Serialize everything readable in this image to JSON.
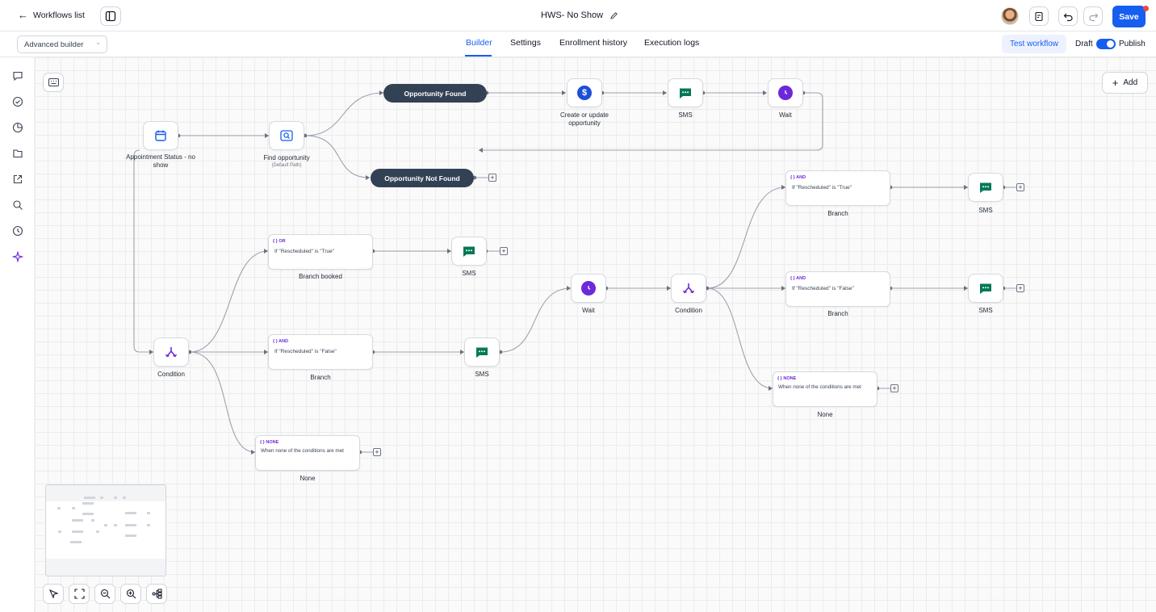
{
  "header": {
    "back_label": "Workflows list",
    "workflow_title": "HWS- No Show",
    "save_label": "Save"
  },
  "subheader": {
    "builder_mode": "Advanced builder",
    "tabs": [
      "Builder",
      "Settings",
      "Enrollment history",
      "Execution logs"
    ],
    "active_tab": "Builder",
    "test_label": "Test workflow",
    "draft_label": "Draft",
    "publish_label": "Publish",
    "published": true
  },
  "canvas": {
    "add_label": "Add",
    "nodes": {
      "trigger": {
        "label": "Appointment Status - no show"
      },
      "find": {
        "label": "Find opportunity",
        "sub": "(Default Path)"
      },
      "opp_found": {
        "label": "Opportunity Found"
      },
      "opp_not_found": {
        "label": "Opportunity Not Found"
      },
      "create_update": {
        "label": "Create or update opportunity"
      },
      "sms1": {
        "label": "SMS"
      },
      "wait1": {
        "label": "Wait"
      },
      "cond1": {
        "label": "Condition"
      },
      "branch_booked": {
        "tag": "OR",
        "cond": "If \"Rescheduled\" is \"True\"",
        "label": "Branch booked"
      },
      "sms2": {
        "label": "SMS"
      },
      "branch_false": {
        "tag": "AND",
        "cond": "If \"Rescheduled\" is \"False\"",
        "label": "Branch"
      },
      "sms3": {
        "label": "SMS"
      },
      "none1": {
        "tag": "NONE",
        "cond": "When none of the conditions are met",
        "label": "None"
      },
      "wait2": {
        "label": "Wait"
      },
      "cond2": {
        "label": "Condition"
      },
      "branch_true2": {
        "tag": "AND",
        "cond": "If \"Rescheduled\" is \"True\"",
        "label": "Branch"
      },
      "sms4": {
        "label": "SMS"
      },
      "branch_false2": {
        "tag": "AND",
        "cond": "If \"Rescheduled\" is \"False\"",
        "label": "Branch"
      },
      "sms5": {
        "label": "SMS"
      },
      "none2": {
        "tag": "NONE",
        "cond": "When none of the conditions are met",
        "label": "None"
      }
    }
  },
  "colors": {
    "accent": "#155eef",
    "dark_pill": "#334155",
    "sms_green": "#047857",
    "wait_purple": "#6d28d9",
    "dollar_blue": "#1d4ed8"
  },
  "icons": {
    "sidebar": [
      "chat-icon",
      "check-circle-icon",
      "pie-chart-icon",
      "folder-icon",
      "external-link-icon",
      "search-icon",
      "history-icon",
      "sparkle-icon"
    ],
    "bottom_toolbar": [
      "pointer-icon",
      "fit-view-icon",
      "zoom-out-icon",
      "zoom-in-icon",
      "auto-layout-icon"
    ]
  }
}
